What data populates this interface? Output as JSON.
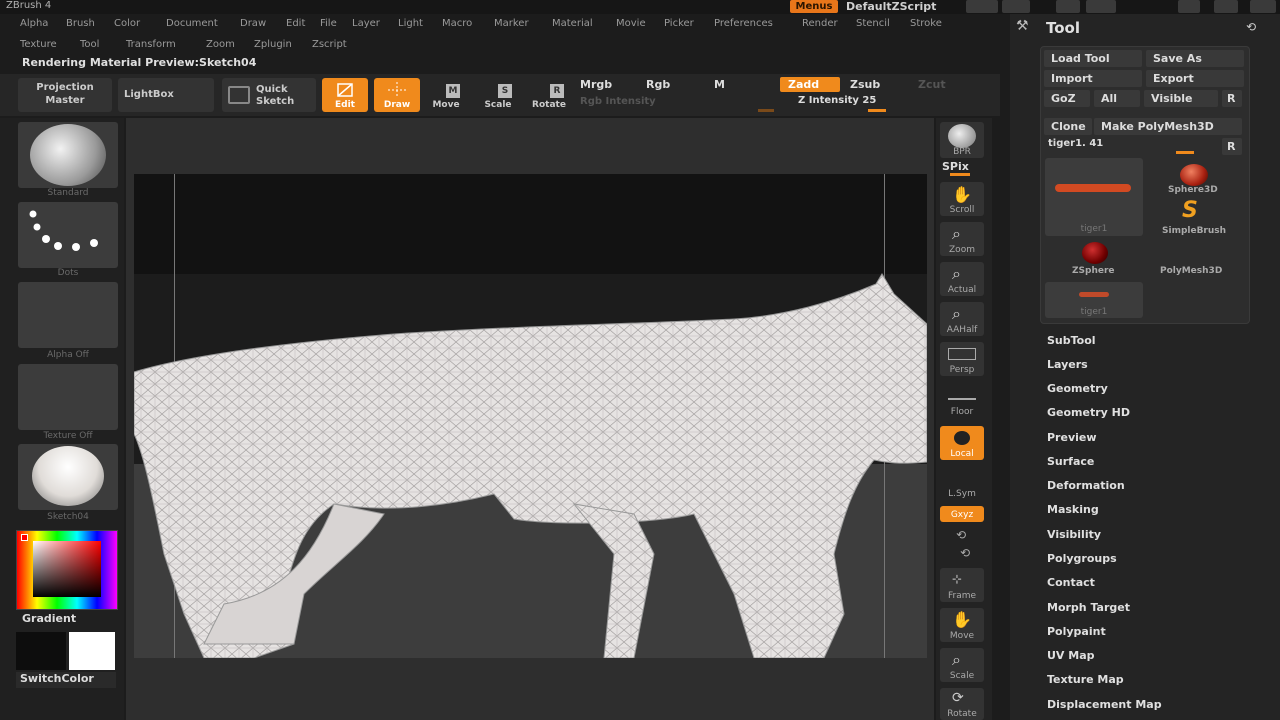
{
  "app": {
    "title": "ZBrush 4"
  },
  "titlebar": {
    "menus_label": "Menus",
    "script_label": "DefaultZScript"
  },
  "menu_row1": [
    "Alpha",
    "Brush",
    "Color",
    "Document",
    "Draw",
    "Edit",
    "File",
    "Layer",
    "Light",
    "Macro",
    "Marker",
    "Material",
    "Movie",
    "Picker",
    "Preferences",
    "Render",
    "Stencil",
    "Stroke"
  ],
  "menu_row2": [
    "Texture",
    "Tool",
    "Transform",
    "Zoom",
    "Zplugin",
    "Zscript"
  ],
  "status": "Rendering Material Preview:Sketch04",
  "toolbar": {
    "projection_master": [
      "Projection",
      "Master"
    ],
    "lightbox": "LightBox",
    "quick_sketch": [
      "Quick",
      "Sketch"
    ],
    "edit": "Edit",
    "draw": "Draw",
    "move": "Move",
    "scale": "Scale",
    "rotate": "Rotate",
    "mrgb": "Mrgb",
    "rgb": "Rgb",
    "m": "M",
    "rgb_intensity": "Rgb Intensity",
    "zadd": "Zadd",
    "zsub": "Zsub",
    "zcut": "Zcut",
    "z_intensity": "Z Intensity 25",
    "z_intensity_value": 25
  },
  "leftshelf": {
    "brush_label": "Standard",
    "stroke_label": "Dots",
    "alpha_label": "Alpha Off",
    "texture_label": "Texture Off",
    "material_label": "Sketch04",
    "gradient_label": "Gradient",
    "switchcolor_label": "SwitchColor",
    "colors": {
      "main": "#111111",
      "secondary": "#ffffff",
      "picker_hue": "#ff0000"
    }
  },
  "rightshelf": {
    "bpr": "BPR",
    "spix": "SPix",
    "scroll": "Scroll",
    "zoom": "Zoom",
    "actual": "Actual",
    "aahalf": "AAHalf",
    "persp": "Persp",
    "floor": "Floor",
    "local": "Local",
    "lsym": "L.Sym",
    "xyz": "Gxyz",
    "frame": "Frame",
    "move": "Move",
    "scale": "Scale",
    "rotate": "Rotate"
  },
  "tool_palette": {
    "title": "Tool",
    "load_tool": "Load Tool",
    "save_as": "Save As",
    "import": "Import",
    "export": "Export",
    "goz": "GoZ",
    "all": "All",
    "visible": "Visible",
    "r": "R",
    "clone": "Clone",
    "make_polymesh": "Make PolyMesh3D",
    "current_tool": "tiger1. 41",
    "tools": [
      {
        "name": "tiger1"
      },
      {
        "name": "Sphere3D"
      },
      {
        "name": "SimpleBrush"
      },
      {
        "name": "ZSphere"
      },
      {
        "name": "PolyMesh3D"
      },
      {
        "name": "tiger1"
      }
    ],
    "sections": [
      "SubTool",
      "Layers",
      "Geometry",
      "Geometry HD",
      "Preview",
      "Surface",
      "Deformation",
      "Masking",
      "Visibility",
      "Polygroups",
      "Contact",
      "Morph Target",
      "Polypaint",
      "UV Map",
      "Texture Map",
      "Displacement Map"
    ]
  },
  "accent_color": "#f08a1c"
}
